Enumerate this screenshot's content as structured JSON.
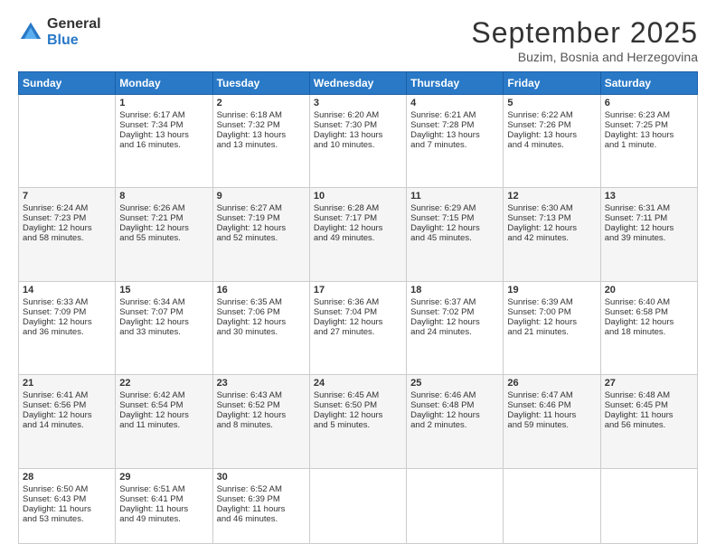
{
  "header": {
    "logo_general": "General",
    "logo_blue": "Blue",
    "month_title": "September 2025",
    "location": "Buzim, Bosnia and Herzegovina"
  },
  "days_header": [
    "Sunday",
    "Monday",
    "Tuesday",
    "Wednesday",
    "Thursday",
    "Friday",
    "Saturday"
  ],
  "weeks": [
    [
      {
        "num": "",
        "lines": []
      },
      {
        "num": "1",
        "lines": [
          "Sunrise: 6:17 AM",
          "Sunset: 7:34 PM",
          "Daylight: 13 hours",
          "and 16 minutes."
        ]
      },
      {
        "num": "2",
        "lines": [
          "Sunrise: 6:18 AM",
          "Sunset: 7:32 PM",
          "Daylight: 13 hours",
          "and 13 minutes."
        ]
      },
      {
        "num": "3",
        "lines": [
          "Sunrise: 6:20 AM",
          "Sunset: 7:30 PM",
          "Daylight: 13 hours",
          "and 10 minutes."
        ]
      },
      {
        "num": "4",
        "lines": [
          "Sunrise: 6:21 AM",
          "Sunset: 7:28 PM",
          "Daylight: 13 hours",
          "and 7 minutes."
        ]
      },
      {
        "num": "5",
        "lines": [
          "Sunrise: 6:22 AM",
          "Sunset: 7:26 PM",
          "Daylight: 13 hours",
          "and 4 minutes."
        ]
      },
      {
        "num": "6",
        "lines": [
          "Sunrise: 6:23 AM",
          "Sunset: 7:25 PM",
          "Daylight: 13 hours",
          "and 1 minute."
        ]
      }
    ],
    [
      {
        "num": "7",
        "lines": [
          "Sunrise: 6:24 AM",
          "Sunset: 7:23 PM",
          "Daylight: 12 hours",
          "and 58 minutes."
        ]
      },
      {
        "num": "8",
        "lines": [
          "Sunrise: 6:26 AM",
          "Sunset: 7:21 PM",
          "Daylight: 12 hours",
          "and 55 minutes."
        ]
      },
      {
        "num": "9",
        "lines": [
          "Sunrise: 6:27 AM",
          "Sunset: 7:19 PM",
          "Daylight: 12 hours",
          "and 52 minutes."
        ]
      },
      {
        "num": "10",
        "lines": [
          "Sunrise: 6:28 AM",
          "Sunset: 7:17 PM",
          "Daylight: 12 hours",
          "and 49 minutes."
        ]
      },
      {
        "num": "11",
        "lines": [
          "Sunrise: 6:29 AM",
          "Sunset: 7:15 PM",
          "Daylight: 12 hours",
          "and 45 minutes."
        ]
      },
      {
        "num": "12",
        "lines": [
          "Sunrise: 6:30 AM",
          "Sunset: 7:13 PM",
          "Daylight: 12 hours",
          "and 42 minutes."
        ]
      },
      {
        "num": "13",
        "lines": [
          "Sunrise: 6:31 AM",
          "Sunset: 7:11 PM",
          "Daylight: 12 hours",
          "and 39 minutes."
        ]
      }
    ],
    [
      {
        "num": "14",
        "lines": [
          "Sunrise: 6:33 AM",
          "Sunset: 7:09 PM",
          "Daylight: 12 hours",
          "and 36 minutes."
        ]
      },
      {
        "num": "15",
        "lines": [
          "Sunrise: 6:34 AM",
          "Sunset: 7:07 PM",
          "Daylight: 12 hours",
          "and 33 minutes."
        ]
      },
      {
        "num": "16",
        "lines": [
          "Sunrise: 6:35 AM",
          "Sunset: 7:06 PM",
          "Daylight: 12 hours",
          "and 30 minutes."
        ]
      },
      {
        "num": "17",
        "lines": [
          "Sunrise: 6:36 AM",
          "Sunset: 7:04 PM",
          "Daylight: 12 hours",
          "and 27 minutes."
        ]
      },
      {
        "num": "18",
        "lines": [
          "Sunrise: 6:37 AM",
          "Sunset: 7:02 PM",
          "Daylight: 12 hours",
          "and 24 minutes."
        ]
      },
      {
        "num": "19",
        "lines": [
          "Sunrise: 6:39 AM",
          "Sunset: 7:00 PM",
          "Daylight: 12 hours",
          "and 21 minutes."
        ]
      },
      {
        "num": "20",
        "lines": [
          "Sunrise: 6:40 AM",
          "Sunset: 6:58 PM",
          "Daylight: 12 hours",
          "and 18 minutes."
        ]
      }
    ],
    [
      {
        "num": "21",
        "lines": [
          "Sunrise: 6:41 AM",
          "Sunset: 6:56 PM",
          "Daylight: 12 hours",
          "and 14 minutes."
        ]
      },
      {
        "num": "22",
        "lines": [
          "Sunrise: 6:42 AM",
          "Sunset: 6:54 PM",
          "Daylight: 12 hours",
          "and 11 minutes."
        ]
      },
      {
        "num": "23",
        "lines": [
          "Sunrise: 6:43 AM",
          "Sunset: 6:52 PM",
          "Daylight: 12 hours",
          "and 8 minutes."
        ]
      },
      {
        "num": "24",
        "lines": [
          "Sunrise: 6:45 AM",
          "Sunset: 6:50 PM",
          "Daylight: 12 hours",
          "and 5 minutes."
        ]
      },
      {
        "num": "25",
        "lines": [
          "Sunrise: 6:46 AM",
          "Sunset: 6:48 PM",
          "Daylight: 12 hours",
          "and 2 minutes."
        ]
      },
      {
        "num": "26",
        "lines": [
          "Sunrise: 6:47 AM",
          "Sunset: 6:46 PM",
          "Daylight: 11 hours",
          "and 59 minutes."
        ]
      },
      {
        "num": "27",
        "lines": [
          "Sunrise: 6:48 AM",
          "Sunset: 6:45 PM",
          "Daylight: 11 hours",
          "and 56 minutes."
        ]
      }
    ],
    [
      {
        "num": "28",
        "lines": [
          "Sunrise: 6:50 AM",
          "Sunset: 6:43 PM",
          "Daylight: 11 hours",
          "and 53 minutes."
        ]
      },
      {
        "num": "29",
        "lines": [
          "Sunrise: 6:51 AM",
          "Sunset: 6:41 PM",
          "Daylight: 11 hours",
          "and 49 minutes."
        ]
      },
      {
        "num": "30",
        "lines": [
          "Sunrise: 6:52 AM",
          "Sunset: 6:39 PM",
          "Daylight: 11 hours",
          "and 46 minutes."
        ]
      },
      {
        "num": "",
        "lines": []
      },
      {
        "num": "",
        "lines": []
      },
      {
        "num": "",
        "lines": []
      },
      {
        "num": "",
        "lines": []
      }
    ]
  ]
}
